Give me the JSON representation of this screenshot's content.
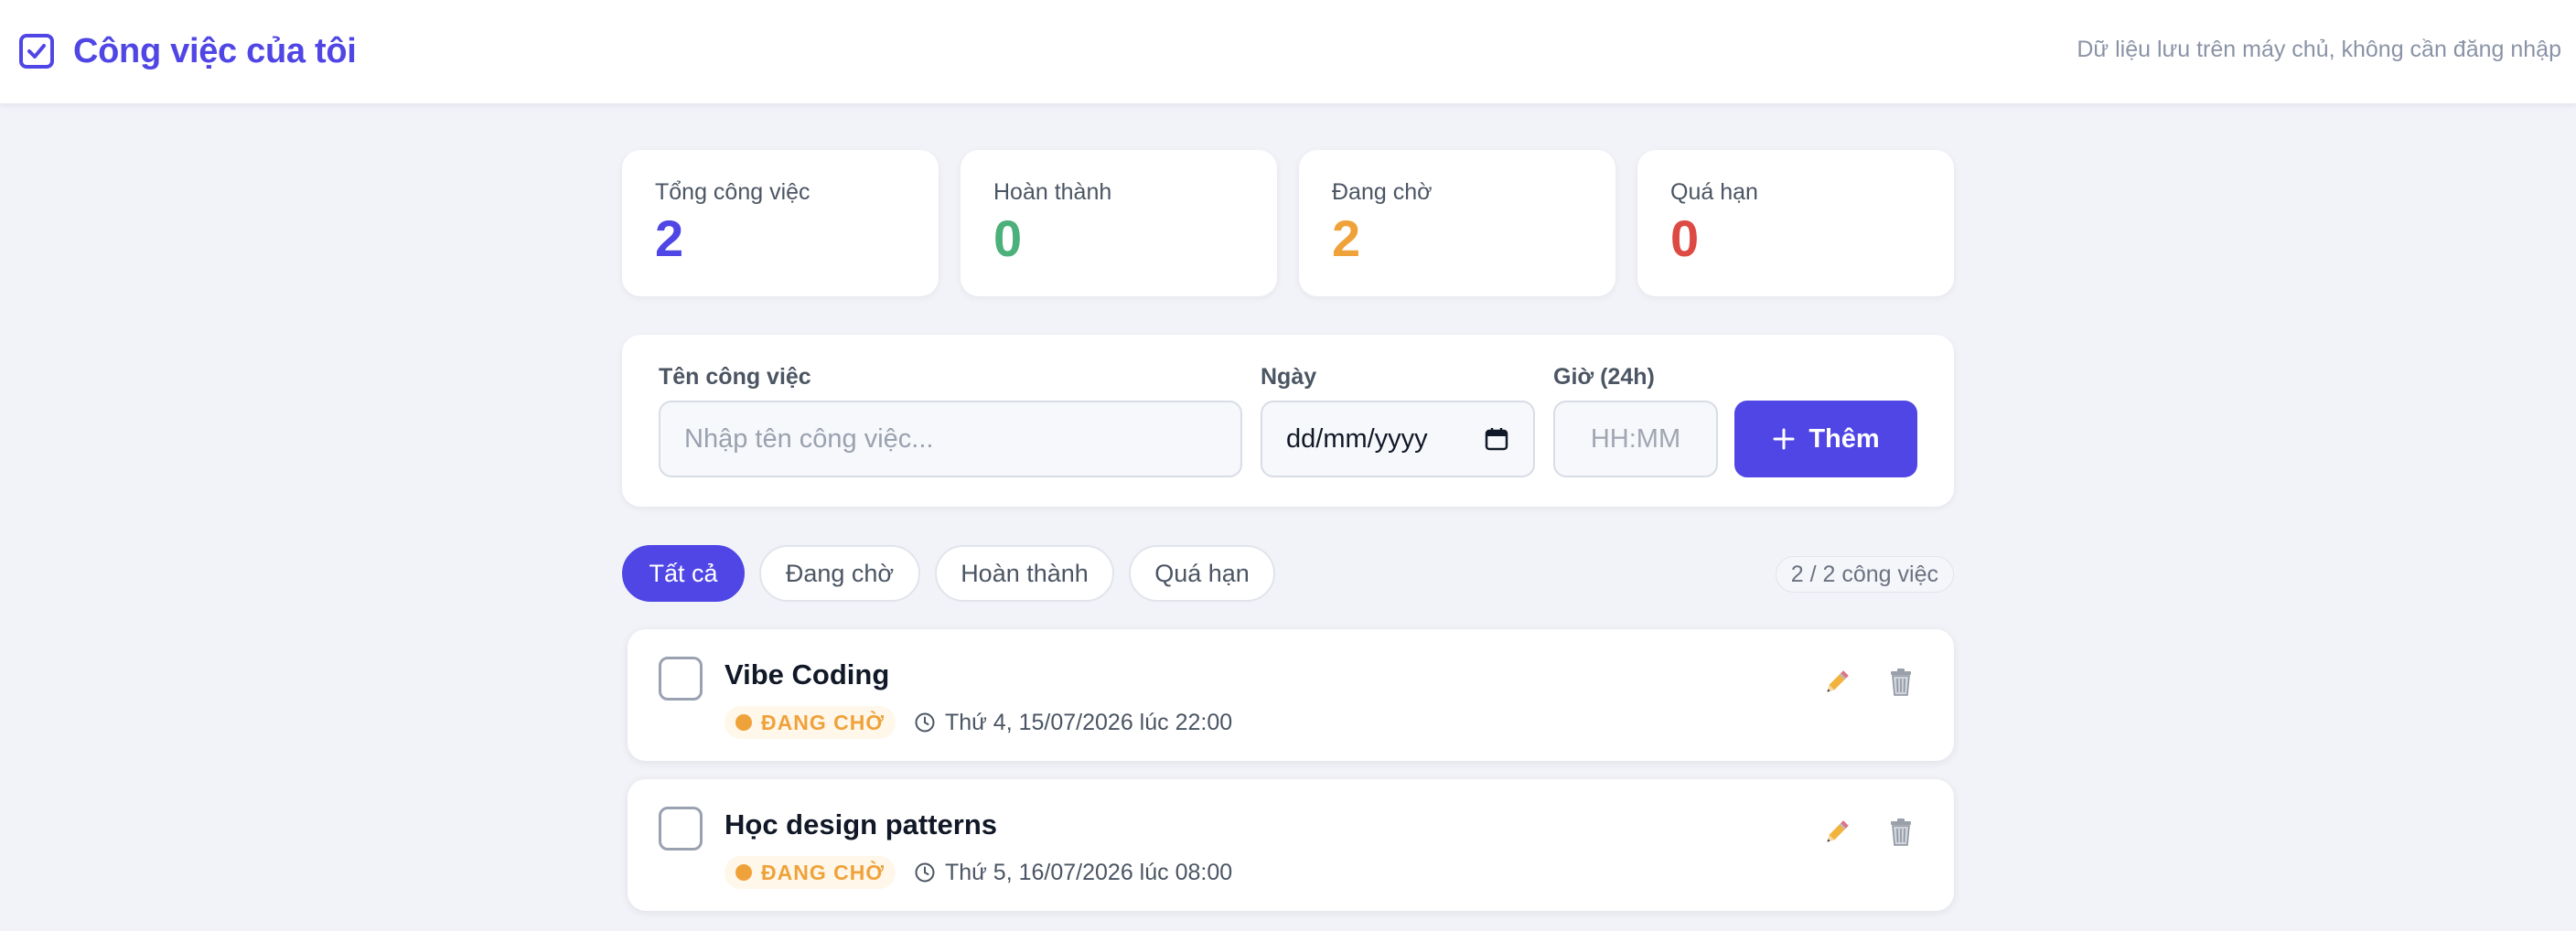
{
  "header": {
    "title": "Công việc của tôi",
    "note": "Dữ liệu lưu trên máy chủ, không cần đăng nhập",
    "accent": "#4f46e5"
  },
  "stats": [
    {
      "label": "Tổng công việc",
      "value": "2",
      "color": "#4f46e5"
    },
    {
      "label": "Hoàn thành",
      "value": "0",
      "color": "#4cb07a"
    },
    {
      "label": "Đang chờ",
      "value": "2",
      "color": "#f0a23a"
    },
    {
      "label": "Quá hạn",
      "value": "0",
      "color": "#dc4a43"
    }
  ],
  "form": {
    "name_label": "Tên công việc",
    "name_placeholder": "Nhập tên công việc...",
    "date_label": "Ngày",
    "date_value": "dd/mm/yyyy",
    "time_label": "Giờ (24h)",
    "time_placeholder": "HH:MM",
    "add_label": "Thêm"
  },
  "filters": {
    "items": [
      "Tất cả",
      "Đang chờ",
      "Hoàn thành",
      "Quá hạn"
    ],
    "active": "Tất cả",
    "count": "2 / 2 công việc"
  },
  "tasks": [
    {
      "title": "Vibe Coding",
      "status": "ĐANG CHỜ",
      "due": "Thứ 4, 15/07/2026 lúc 22:00",
      "done": false
    },
    {
      "title": "Học design patterns",
      "status": "ĐANG CHỜ",
      "due": "Thứ 5, 16/07/2026 lúc 08:00",
      "done": false
    }
  ],
  "icons": {
    "brand": "checkbox-icon",
    "calendar": "calendar-icon",
    "add": "plus-icon",
    "clock": "clock-icon",
    "edit": "pencil-icon",
    "delete": "trash-icon"
  }
}
